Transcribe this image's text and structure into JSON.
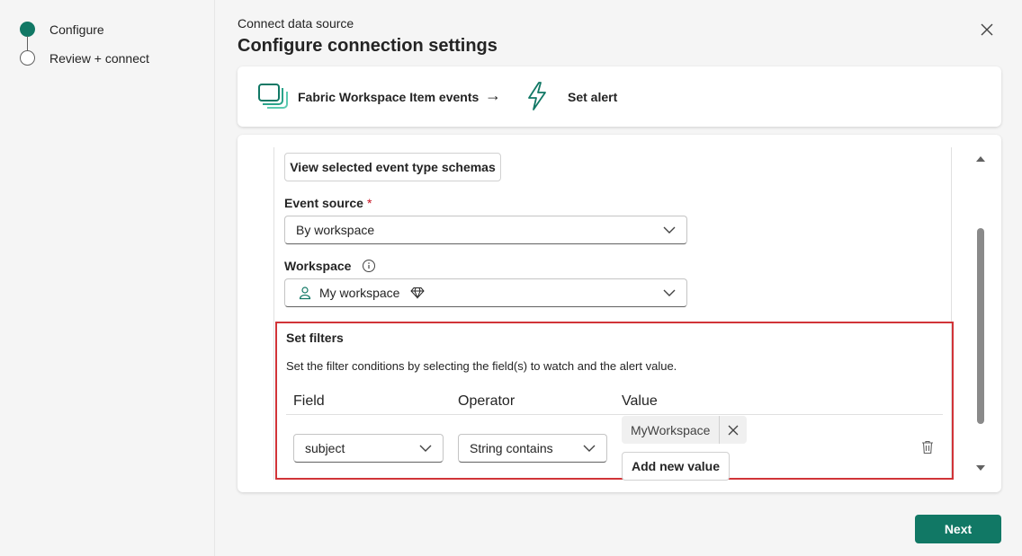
{
  "stepper": {
    "steps": [
      {
        "label": "Configure",
        "state": "current"
      },
      {
        "label": "Review + connect",
        "state": "pending"
      }
    ]
  },
  "dialog": {
    "eyebrow": "Connect data source",
    "title": "Configure connection settings"
  },
  "flow": {
    "source_label": "Fabric Workspace Item events",
    "arrow": "→",
    "destination_label": "Set alert"
  },
  "form": {
    "view_schemas_label": "View selected event type schemas",
    "event_source": {
      "label": "Event source",
      "required_mark": "*",
      "value": "By workspace"
    },
    "workspace": {
      "label": "Workspace",
      "value": "My workspace"
    }
  },
  "filters": {
    "title": "Set filters",
    "description": "Set the filter conditions by selecting the field(s) to watch and the alert value.",
    "columns": {
      "field": "Field",
      "operator": "Operator",
      "value": "Value"
    },
    "rows": [
      {
        "field": "subject",
        "operator": "String contains",
        "values": [
          "MyWorkspace"
        ]
      }
    ],
    "add_value_label": "Add new value"
  },
  "footer": {
    "next_label": "Next"
  },
  "colors": {
    "accent": "#117865",
    "highlight_border": "#d13438"
  }
}
